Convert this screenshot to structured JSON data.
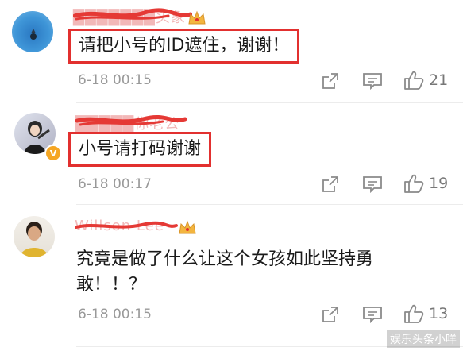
{
  "comments": [
    {
      "username": "███████头象",
      "text": "请把小号的ID遮住，谢谢！",
      "time": "6-18 00:15",
      "likes": "21",
      "highlighted": true
    },
    {
      "username": "█████你老公",
      "text": "小号请打码谢谢",
      "time": "6-18 00:17",
      "likes": "19",
      "highlighted": true
    },
    {
      "username": "Willson Lee",
      "text_line1": "究竟是做了什么让这个女孩如此坚持勇",
      "text_line2": "敢！！？",
      "time": "6-18 00:15",
      "likes": "13",
      "highlighted": false
    }
  ],
  "watermark": "娱乐头条小咩",
  "colors": {
    "highlight_box": "#e2302f",
    "redaction": "#e53935",
    "vip_badge": "#f5a623",
    "crown": "#f3b53f"
  },
  "icons": [
    "share-icon",
    "reply-icon",
    "like-icon",
    "crown-icon"
  ]
}
